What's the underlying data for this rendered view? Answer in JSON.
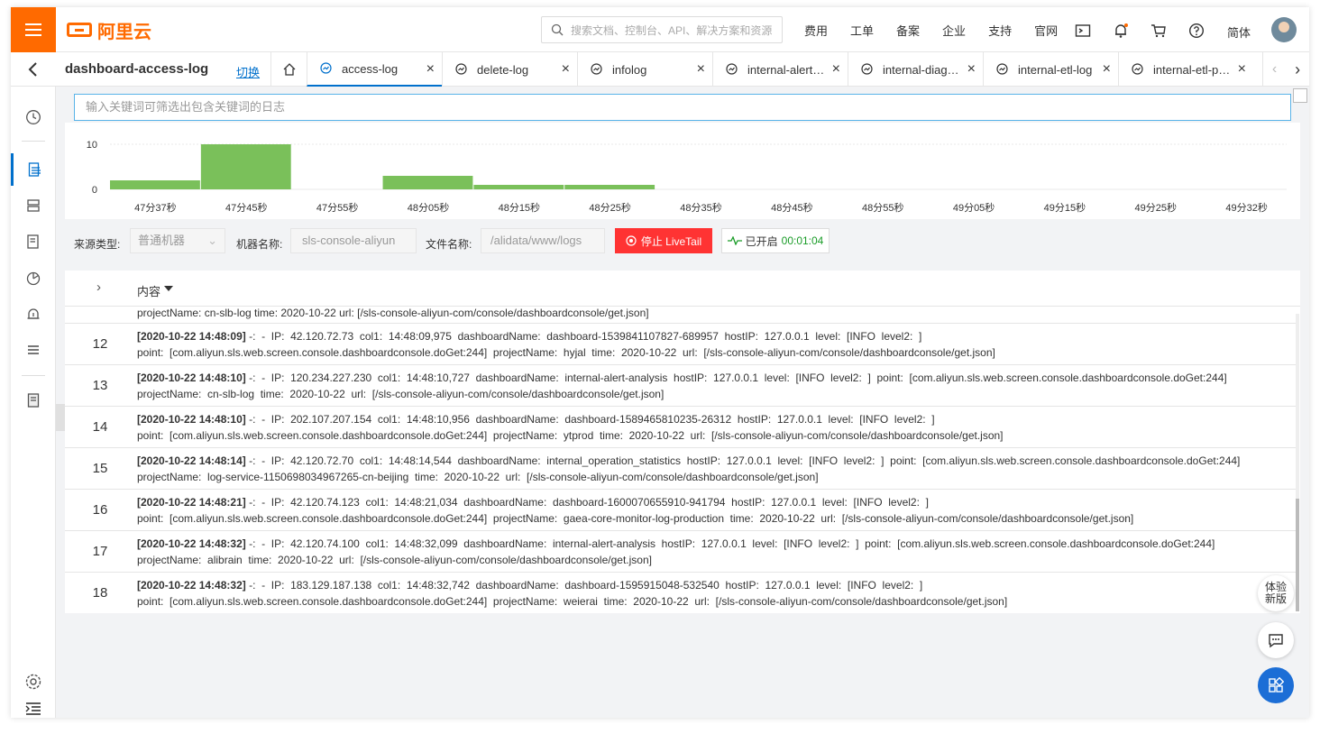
{
  "topbar": {
    "search_placeholder": "搜索文档、控制台、API、解决方案和资源",
    "logo_text": "阿里云",
    "nav": [
      "费用",
      "工单",
      "备案",
      "企业",
      "支持",
      "官网"
    ],
    "lang": "简体"
  },
  "tabbar": {
    "logstore": "dashboard-access-log",
    "switch_label": "切换",
    "tabs": [
      {
        "label": "access-log"
      },
      {
        "label": "delete-log"
      },
      {
        "label": "infolog"
      },
      {
        "label": "internal-alert-…"
      },
      {
        "label": "internal-diag…"
      },
      {
        "label": "internal-etl-log"
      },
      {
        "label": "internal-etl-pr…"
      }
    ]
  },
  "search": {
    "placeholder": "输入关键词可筛选出包含关键词的日志"
  },
  "chart_data": {
    "type": "bar",
    "ylim": [
      0,
      10
    ],
    "yticks": [
      "10",
      "0"
    ],
    "categories": [
      "47分37秒",
      "47分45秒",
      "47分55秒",
      "48分05秒",
      "48分15秒",
      "48分25秒",
      "48分35秒",
      "48分45秒",
      "48分55秒",
      "49分05秒",
      "49分15秒",
      "49分25秒",
      "49分32秒"
    ],
    "values": [
      2,
      10,
      0,
      3,
      1,
      1,
      0,
      0,
      0,
      0,
      0,
      0,
      0
    ],
    "color": "#7ac05a"
  },
  "filters": {
    "source_label": "来源类型:",
    "source_value": "普通机器",
    "machine_label": "机器名称:",
    "machine_value": "sls-console-aliyun",
    "file_label": "文件名称:",
    "file_value": "/alidata/www/logs",
    "stop_label": "停止 LiveTail",
    "status_label": "已开启",
    "status_time": "00:01:04"
  },
  "table": {
    "header": "内容",
    "partial_row": "projectName:  cn-slb-log  time:  2020-10-22  url:  [/sls-console-aliyun-com/console/dashboardconsole/get.json]",
    "rows": [
      {
        "num": "12",
        "ts": "[2020-10-22 14:48:09]",
        "l1": " -:  -  IP:  42.120.72.73  col1:  14:48:09,975  dashboardName:  dashboard-1539841107827-689957  hostIP:  127.0.0.1  level:  [INFO  level2:  ]",
        "l2": "point:  [com.aliyun.sls.web.screen.console.dashboardconsole.doGet:244]  projectName:  hyjal  time:  2020-10-22  url:  [/sls-console-aliyun-com/console/dashboardconsole/get.json]"
      },
      {
        "num": "13",
        "ts": "[2020-10-22 14:48:10]",
        "l1": " -:  -  IP:  120.234.227.230  col1:  14:48:10,727  dashboardName:  internal-alert-analysis  hostIP:  127.0.0.1  level:  [INFO  level2:  ]  point:  [com.aliyun.sls.web.screen.console.dashboardconsole.doGet:244]",
        "l2": "projectName:  cn-slb-log  time:  2020-10-22  url:  [/sls-console-aliyun-com/console/dashboardconsole/get.json]"
      },
      {
        "num": "14",
        "ts": "[2020-10-22 14:48:10]",
        "l1": " -:  -  IP:  202.107.207.154  col1:  14:48:10,956  dashboardName:  dashboard-1589465810235-26312  hostIP:  127.0.0.1  level:  [INFO  level2:  ]",
        "l2": "point:  [com.aliyun.sls.web.screen.console.dashboardconsole.doGet:244]  projectName:  ytprod  time:  2020-10-22  url:  [/sls-console-aliyun-com/console/dashboardconsole/get.json]"
      },
      {
        "num": "15",
        "ts": "[2020-10-22 14:48:14]",
        "l1": " -:  -  IP:  42.120.72.70  col1:  14:48:14,544  dashboardName:  internal_operation_statistics  hostIP:  127.0.0.1  level:  [INFO  level2:  ]  point:  [com.aliyun.sls.web.screen.console.dashboardconsole.doGet:244]",
        "l2": "projectName:  log-service-1150698034967265-cn-beijing  time:  2020-10-22  url:  [/sls-console-aliyun-com/console/dashboardconsole/get.json]"
      },
      {
        "num": "16",
        "ts": "[2020-10-22 14:48:21]",
        "l1": " -:  -  IP:  42.120.74.123  col1:  14:48:21,034  dashboardName:  dashboard-1600070655910-941794  hostIP:  127.0.0.1  level:  [INFO  level2:  ]",
        "l2": "point:  [com.aliyun.sls.web.screen.console.dashboardconsole.doGet:244]  projectName:  gaea-core-monitor-log-production  time:  2020-10-22  url:  [/sls-console-aliyun-com/console/dashboardconsole/get.json]"
      },
      {
        "num": "17",
        "ts": "[2020-10-22 14:48:32]",
        "l1": " -:  -  IP:  42.120.74.100  col1:  14:48:32,099  dashboardName:  internal-alert-analysis  hostIP:  127.0.0.1  level:  [INFO  level2:  ]  point:  [com.aliyun.sls.web.screen.console.dashboardconsole.doGet:244]",
        "l2": "projectName:  alibrain  time:  2020-10-22  url:  [/sls-console-aliyun-com/console/dashboardconsole/get.json]"
      },
      {
        "num": "18",
        "ts": "[2020-10-22 14:48:32]",
        "l1": " -:  -  IP:  183.129.187.138  col1:  14:48:32,742  dashboardName:  dashboard-1595915048-532540  hostIP:  127.0.0.1  level:  [INFO  level2:  ]",
        "l2": "point:  [com.aliyun.sls.web.screen.console.dashboardconsole.doGet:244]  projectName:  weierai  time:  2020-10-22  url:  [/sls-console-aliyun-com/console/dashboardconsole/get.json]"
      }
    ]
  },
  "fab": {
    "new_version": "体验新版"
  }
}
